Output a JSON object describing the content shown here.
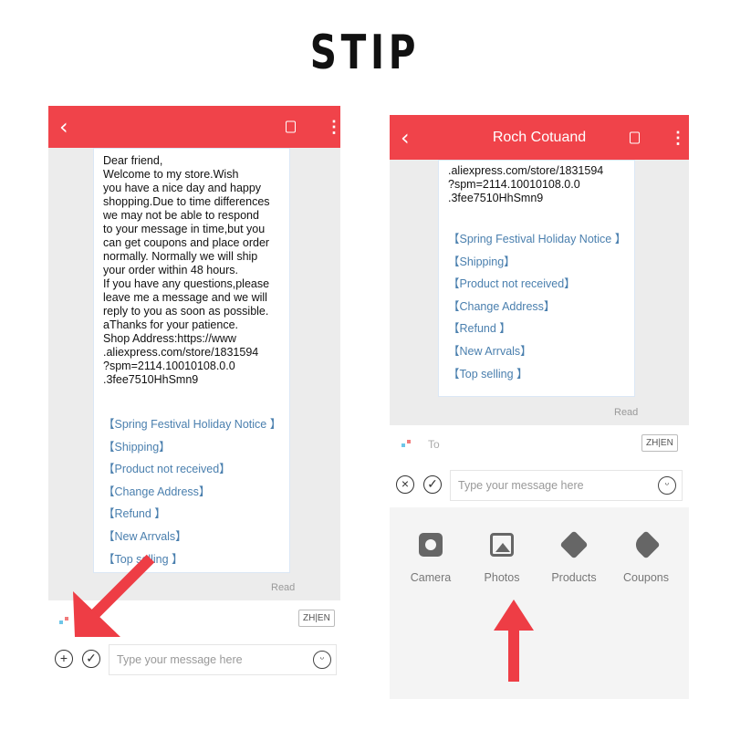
{
  "title": "STIP",
  "left": {
    "header": {
      "back": "‹"
    },
    "message": "Dear friend,\nWelcome to my store.Wish\nyou have a nice day and happy\nshopping.Due to time differences\nwe may not be able to respond\nto your message in time,but you\ncan get coupons and place order\nnormally. Normally we will ship\nyour order within 48 hours.\nIf you have any questions,please\nleave me a message and we will\nreply to you as soon as possible.\naThanks for your patience.\nShop Address:https://www\n.aliexpress.com/store/1831594\n?spm=2114.10010108.0.0\n.3fee7510HhSmn9",
    "links": [
      "【Spring Festival Holiday Notice 】",
      "【Shipping】",
      "【Product not received】",
      "【Change Address】",
      "【Refund 】",
      "【New Arrvals】",
      "【Top selling 】"
    ],
    "read": "Read",
    "lang": "ZH|EN",
    "input_placeholder": "Type your message here"
  },
  "right": {
    "header": {
      "back": "‹",
      "name": "Roch Cotuand"
    },
    "message": ".aliexpress.com/store/1831594\n?spm=2114.10010108.0.0\n.3fee7510HhSmn9",
    "links": [
      "【Spring Festival Holiday Notice 】",
      "【Shipping】",
      "【Product not received】",
      "【Change Address】",
      "【Refund 】",
      "【New Arrvals】",
      "【Top selling 】"
    ],
    "read": "Read",
    "to": "To",
    "lang": "ZH|EN",
    "input_placeholder": "Type your message here",
    "attachments": [
      {
        "label": "Camera",
        "icon": "camera-icon"
      },
      {
        "label": "Photos",
        "icon": "photos-icon"
      },
      {
        "label": "Products",
        "icon": "box-icon"
      },
      {
        "label": "Coupons",
        "icon": "tag-icon"
      }
    ]
  },
  "colors": {
    "header": "#f0434a",
    "arrow": "#ee3d45",
    "link": "#4a7fae"
  }
}
